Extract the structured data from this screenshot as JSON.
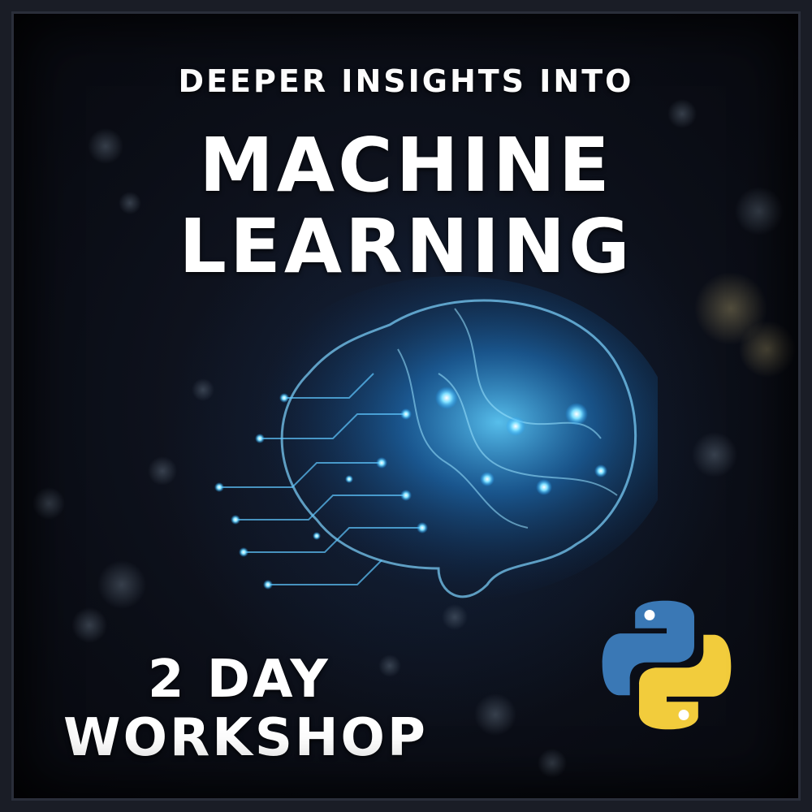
{
  "title": {
    "kicker": "DEEPER INSIGHTS INTO",
    "line1": "MACHINE",
    "line2": "LEARNING"
  },
  "badge": {
    "days": "2 DAY",
    "label": "WORKSHOP"
  },
  "icons": {
    "brain": "circuit-brain-icon",
    "logo": "python-logo-icon"
  },
  "colors": {
    "background": "#0b0e17",
    "text": "#ffffff",
    "brain_glow": "#2ea8ff",
    "python_blue": "#3a78b5",
    "python_yellow": "#f2cc3c"
  }
}
